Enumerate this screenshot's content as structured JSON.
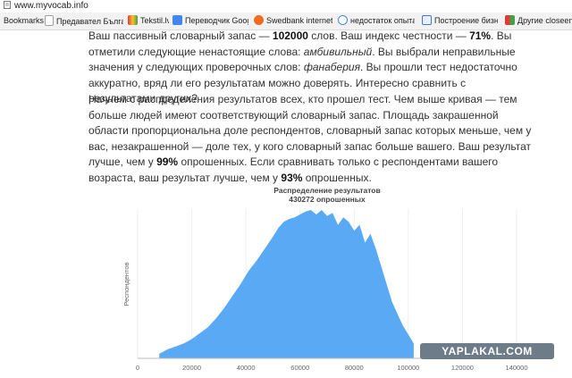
{
  "address_bar": {
    "url": "www.myvocab.info"
  },
  "bookmarks": [
    {
      "label": "Bookmarks",
      "icon": "bookmark-icon",
      "color": "#f2f2f2"
    },
    {
      "label": "Предавател Българ",
      "icon": "page-icon",
      "color": "#9e9e9e"
    },
    {
      "label": "Tekstil.lv",
      "icon": "tekstil-icon",
      "color": "#d9473e"
    },
    {
      "label": "Переводчик Google",
      "icon": "translate-icon",
      "color": "#4285f4"
    },
    {
      "label": "Swedbank internetba",
      "icon": "swedbank-icon",
      "color": "#f26b21"
    },
    {
      "label": "недостаток опыта -",
      "icon": "google-icon",
      "color": "#4285f4"
    },
    {
      "label": "Построение бизнес",
      "icon": "page-icon",
      "color": "#3b78e7"
    },
    {
      "label": "Другие closeenable",
      "icon": "folder-icon",
      "color": "#f4c430"
    }
  ],
  "article": {
    "p1": {
      "a": "Ваш пассивный словарный запас — ",
      "vocab": "102000",
      "b": " слов. Ваш индекс честности — ",
      "honesty": "71%",
      "c": ". Вы отметили следующие ненастоящие слова: ",
      "fake_word": "амбивильный",
      "d": ". Вы выбрали неправильные значения у следующих проверочных слов: ",
      "wrong_word": "фанаберия",
      "e": ". Вы прошли тест недостаточно аккуратно, вряд ли его результатам можно доверять. Интересно сравнить с результатами других?"
    },
    "p2": {
      "a": "Начнем с распределения результатов всех, кто прошел тест. Чем выше кривая — тем больше людей имеют соответствующий словарный запас. Площадь закрашенной области пропорциональна доле респондентов, словарный запас которых меньше, чем у вас, незакрашенной — доле тех, у кого словарный запас больше вашего. Ваш результат лучше, чем у ",
      "pct_all": "99%",
      "b": " опрошенных. Если сравнивать только с респондентами вашего возраста, ваш результат лучше, чем у ",
      "pct_age": "93%",
      "c": " опрошенных."
    }
  },
  "chart_data": {
    "type": "area",
    "title": "Распределение результатов",
    "subtitle": "430272 опрошенных",
    "xlabel": "",
    "ylabel": "Респондентов",
    "xlim": [
      0,
      140000
    ],
    "x_ticks": [
      0,
      20000,
      40000,
      60000,
      80000,
      100000,
      120000,
      140000
    ],
    "grid": true,
    "fill_color": "#5aa9f5",
    "shaded_until": 102000,
    "x": [
      8000,
      11000,
      14000,
      17000,
      20000,
      23000,
      26000,
      29000,
      32000,
      35000,
      38000,
      41000,
      44000,
      47000,
      50000,
      52000,
      54000,
      56000,
      58000,
      60000,
      62000,
      64000,
      66000,
      68000,
      70000,
      72000,
      74000,
      76000,
      78000,
      80000,
      82000,
      84000,
      86000,
      88000,
      90000,
      92000,
      94000,
      96000,
      98000,
      100000,
      102000
    ],
    "values": [
      0.03,
      0.06,
      0.08,
      0.1,
      0.13,
      0.17,
      0.21,
      0.27,
      0.34,
      0.42,
      0.5,
      0.59,
      0.66,
      0.74,
      0.82,
      0.88,
      0.92,
      0.94,
      0.95,
      0.97,
      0.99,
      1.0,
      0.97,
      1.0,
      0.96,
      0.98,
      0.9,
      0.95,
      0.92,
      0.86,
      0.9,
      0.78,
      0.84,
      0.74,
      0.62,
      0.5,
      0.38,
      0.3,
      0.22,
      0.16,
      0.1
    ]
  },
  "watermark": {
    "text": "YAPLAKAL.COM"
  }
}
